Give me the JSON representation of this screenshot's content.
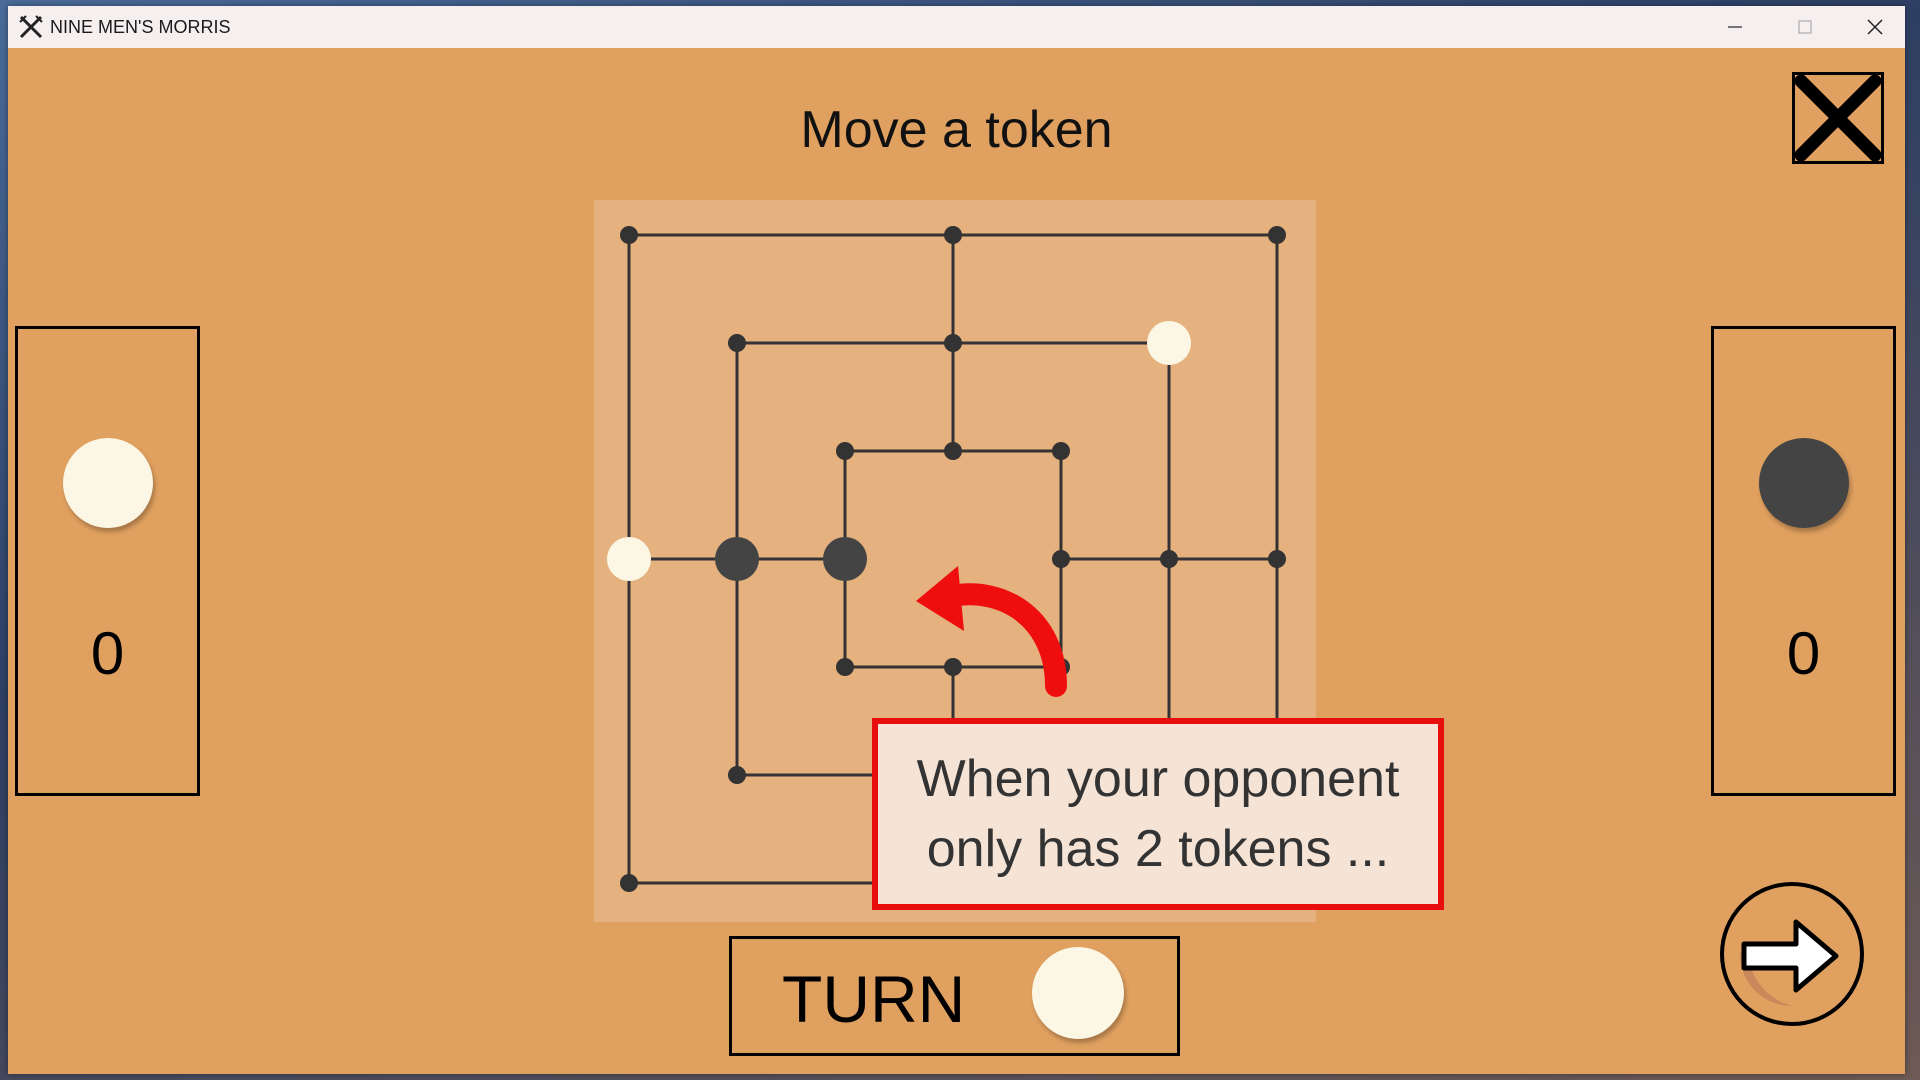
{
  "window": {
    "title": "NINE MEN'S MORRIS",
    "icon": "crossed-swords-icon",
    "controls": [
      "minimize-icon",
      "maximize-icon",
      "close-icon"
    ]
  },
  "header": {
    "instruction": "Move a token",
    "exit_icon": "x-exit-icon"
  },
  "players": {
    "left": {
      "token": "white",
      "count": "0"
    },
    "right": {
      "token": "black",
      "count": "0"
    }
  },
  "board": {
    "positions": [
      {
        "id": "a1",
        "token": "none"
      },
      {
        "id": "d1",
        "token": "none"
      },
      {
        "id": "g1",
        "token": "none"
      },
      {
        "id": "b2",
        "token": "none"
      },
      {
        "id": "d2",
        "token": "none"
      },
      {
        "id": "f2",
        "token": "white"
      },
      {
        "id": "c3",
        "token": "none"
      },
      {
        "id": "d3",
        "token": "none"
      },
      {
        "id": "e3",
        "token": "none"
      },
      {
        "id": "a4",
        "token": "white"
      },
      {
        "id": "b4",
        "token": "black"
      },
      {
        "id": "c4",
        "token": "black"
      },
      {
        "id": "e4",
        "token": "none"
      },
      {
        "id": "f4",
        "token": "none"
      },
      {
        "id": "g4",
        "token": "none"
      },
      {
        "id": "c5",
        "token": "none"
      },
      {
        "id": "d5",
        "token": "none"
      },
      {
        "id": "e5",
        "token": "none"
      },
      {
        "id": "b6",
        "token": "none"
      },
      {
        "id": "a7",
        "token": "none"
      }
    ]
  },
  "tooltip": {
    "line1": "When your opponent",
    "line2": "only has 2 tokens ..."
  },
  "turn": {
    "label": "TURN",
    "token": "white"
  },
  "next_button": {
    "icon": "arrow-right-icon"
  },
  "colors": {
    "background": "#E0A05F",
    "board": "#E5B17E",
    "white_token": "#FBF7E4",
    "black_token": "#444444",
    "highlight": "#E80E0E",
    "tooltip_bg": "#F5E3D5"
  }
}
